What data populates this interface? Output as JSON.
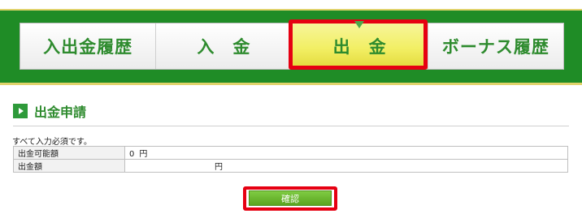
{
  "nav": {
    "tabs": [
      {
        "label": "入出金履歴"
      },
      {
        "label": "入　金"
      },
      {
        "label": "出　金"
      },
      {
        "label": "ボーナス履歴"
      }
    ],
    "active_index": 2
  },
  "section": {
    "title": "出金申請",
    "icon": "play-icon"
  },
  "form": {
    "note": "すべて入力必須です。",
    "rows": [
      {
        "label": "出金可能額",
        "value": "0",
        "unit": "円"
      },
      {
        "label": "出金額",
        "value": "",
        "unit": "円"
      }
    ]
  },
  "confirm_button": {
    "label": "確認"
  },
  "colors": {
    "band": "#1f8c26",
    "band_border": "#e1d36c",
    "tab_text": "#2e8b2e",
    "active_tab": "#f2ef64",
    "highlight": "#e60012",
    "button": "#6bb82f"
  }
}
